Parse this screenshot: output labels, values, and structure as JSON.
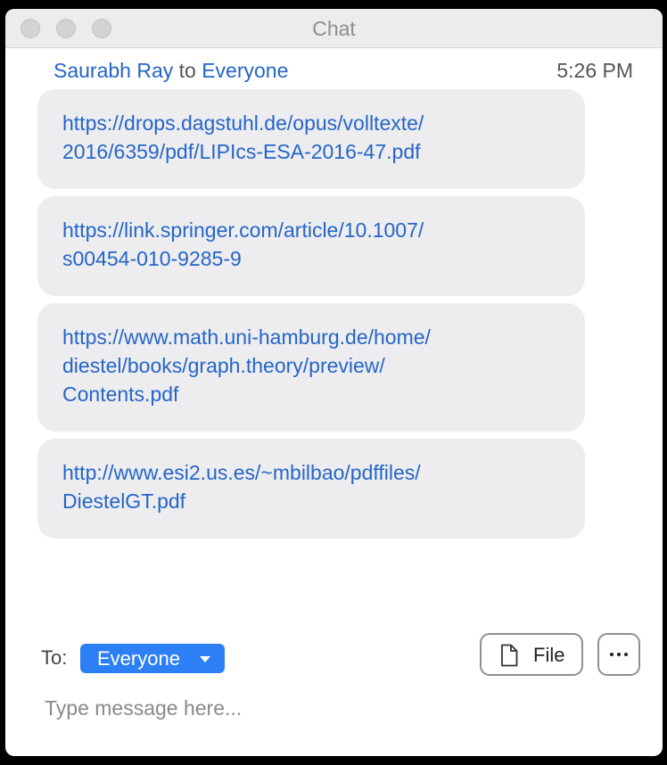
{
  "window": {
    "title": "Chat"
  },
  "message": {
    "sender": "Saurabh Ray",
    "connector": "to",
    "recipient": "Everyone",
    "time": "5:26 PM",
    "links": [
      {
        "line1": "https://drops.dagstuhl.de/opus/volltexte/",
        "line2": "2016/6359/pdf/LIPIcs-ESA-2016-47.pdf"
      },
      {
        "line1": "https://link.springer.com/article/10.1007/",
        "line2": "s00454-010-9285-9"
      },
      {
        "line1": "https://www.math.uni-hamburg.de/home/",
        "line2": "diestel/books/graph.theory/preview/",
        "line3": "Contents.pdf"
      },
      {
        "line1": "http://www.esi2.us.es/~mbilbao/pdffiles/",
        "line2": "DiestelGT.pdf"
      }
    ]
  },
  "composer": {
    "to_label": "To:",
    "recipient": "Everyone",
    "file_label": "File",
    "placeholder": "Type message here..."
  },
  "icons": {
    "traffic_lights": [
      "close-icon",
      "minimize-icon",
      "zoom-icon"
    ],
    "file": "document-icon",
    "more": "ellipsis-icon",
    "dropdown": "caret-down-icon"
  },
  "colors": {
    "link": "#2565c7",
    "recipient_pill": "#2d7ff5",
    "bubble": "#ededf0"
  }
}
